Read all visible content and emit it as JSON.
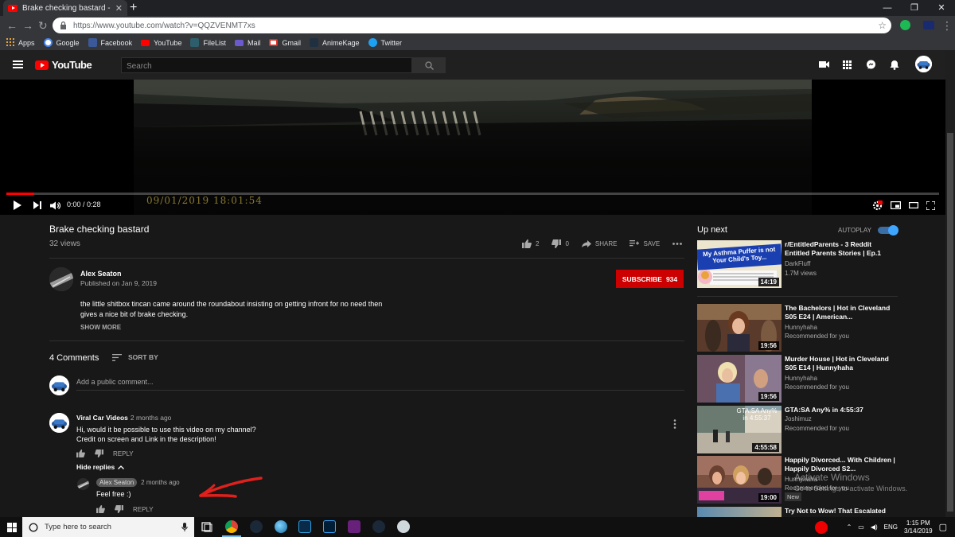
{
  "browser": {
    "tab_title": "Brake checking bastard - YouTube",
    "url": "https://www.youtube.com/watch?v=QQZVENMT7xs",
    "bookmarks": [
      {
        "label": "Apps",
        "icon": "apps-grid-icon"
      },
      {
        "label": "Google",
        "icon": "google-icon"
      },
      {
        "label": "Facebook",
        "icon": "facebook-icon"
      },
      {
        "label": "YouTube",
        "icon": "youtube-icon"
      },
      {
        "label": "FileList",
        "icon": "filelist-icon"
      },
      {
        "label": "Mail",
        "icon": "mail-icon"
      },
      {
        "label": "Gmail",
        "icon": "gmail-icon"
      },
      {
        "label": "AnimeKage",
        "icon": "animekage-icon"
      },
      {
        "label": "Twitter",
        "icon": "twitter-icon"
      }
    ]
  },
  "masthead": {
    "logo_text": "YouTube",
    "search_placeholder": "Search"
  },
  "player": {
    "timecode": "0:00 / 0:28",
    "overlay_datetime": "09/01/2019  18:01:54",
    "progress": 0.03
  },
  "video": {
    "title": "Brake checking bastard",
    "views": "32 views",
    "likes": "2",
    "dislikes": "0",
    "share_label": "SHARE",
    "save_label": "SAVE",
    "owner_name": "Alex Seaton",
    "published": "Published on Jan 9, 2019",
    "subscribe_label": "SUBSCRIBE",
    "subscriber_count": "934",
    "description_lines": [
      "the little shitbox tincan came around the roundabout insisting on getting infront for no need then",
      "gives a nice bit of brake checking."
    ],
    "show_more": "SHOW MORE"
  },
  "comments": {
    "count_label": "4 Comments",
    "sort_label": "SORT BY",
    "add_placeholder": "Add a public comment...",
    "items": [
      {
        "author": "Viral Car Videos",
        "ago": "2 months ago",
        "lines": [
          "Hi, would it be possible to use this video on my channel?",
          "Credit on screen and Link in the description!"
        ],
        "reply_label": "REPLY",
        "hide_replies": "Hide replies",
        "replies": [
          {
            "author": "Alex Seaton",
            "ago": "2 months ago",
            "text": "Feel free :)",
            "reply_label": "REPLY"
          }
        ]
      }
    ]
  },
  "upnext": {
    "label": "Up next",
    "autoplay_label": "AUTOPLAY",
    "autoplay_on": true,
    "items": [
      {
        "title": "r/EntitledParents - 3 Reddit Entitled Parents Stories | Ep.1",
        "channel": "DarkFluff",
        "meta": "1.7M views",
        "duration": "14:19",
        "thumb_text": "My Asthma Puffer is not Your Child's Toy..."
      },
      {
        "title": "The Bachelors | Hot in Cleveland S05 E24 | American...",
        "channel": "Hunnyhaha",
        "meta": "Recommended for you",
        "duration": "19:56"
      },
      {
        "title": "Murder House | Hot in Cleveland S05 E14 | Hunnyhaha",
        "channel": "Hunnyhaha",
        "meta": "Recommended for you",
        "duration": "19:56"
      },
      {
        "title": "GTA:SA Any% in 4:55:37",
        "channel": "Joshimuz",
        "meta": "Recommended for you",
        "duration": "4:55:58",
        "thumb_text": "GTA:SA Any% in 4:55:37"
      },
      {
        "title": "Happily Divorced... With Children | Happily Divorced S2...",
        "channel": "Hunnyhaha",
        "meta": "Recommended for you",
        "duration": "19:00",
        "badge": "New"
      },
      {
        "title": "Try Not to Wow! That Escalated",
        "channel": "",
        "meta": "",
        "duration": ""
      }
    ]
  },
  "watermark": {
    "line1": "Activate Windows",
    "line2": "Go to Settings to activate Windows."
  },
  "taskbar": {
    "search_placeholder": "Type here to search",
    "language": "ENG",
    "time": "1:15 PM",
    "date": "3/14/2019"
  },
  "colors": {
    "youtube_red": "#ff0000",
    "subscribe_red": "#cc0000",
    "autoplay_blue": "#3ea6ff",
    "arrow_red": "#e0201c",
    "page_bg": "#181818"
  }
}
